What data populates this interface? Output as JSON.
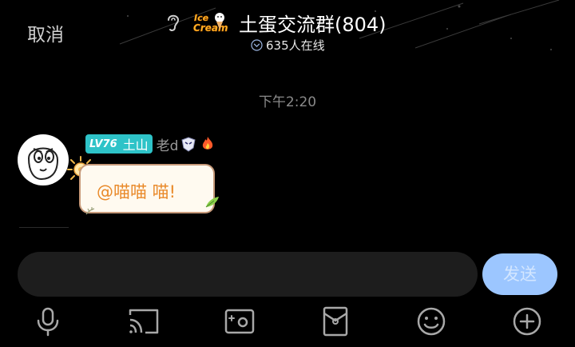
{
  "header": {
    "cancel_label": "取消",
    "group_title": "土蛋交流群(804)",
    "online_text": "635人在线"
  },
  "chat": {
    "timestamp": "下午2:20",
    "messages": [
      {
        "level": "LV76",
        "level_name": "土山",
        "nickname": "老d",
        "text": "@喵喵 喵!"
      }
    ]
  },
  "composer": {
    "send_label": "发送"
  },
  "toolbar": {
    "icons": [
      "microphone-icon",
      "cast-screen-icon",
      "photo-icon",
      "red-packet-icon",
      "emoji-icon",
      "plus-icon"
    ]
  },
  "colors": {
    "background": "#000000",
    "level_badge": "#2ec3c8",
    "send_button": "#9cc6ff",
    "bubble_text": "#e98a2a",
    "bubble_border": "#c79a7a",
    "input_bg": "#1d1d1d"
  }
}
